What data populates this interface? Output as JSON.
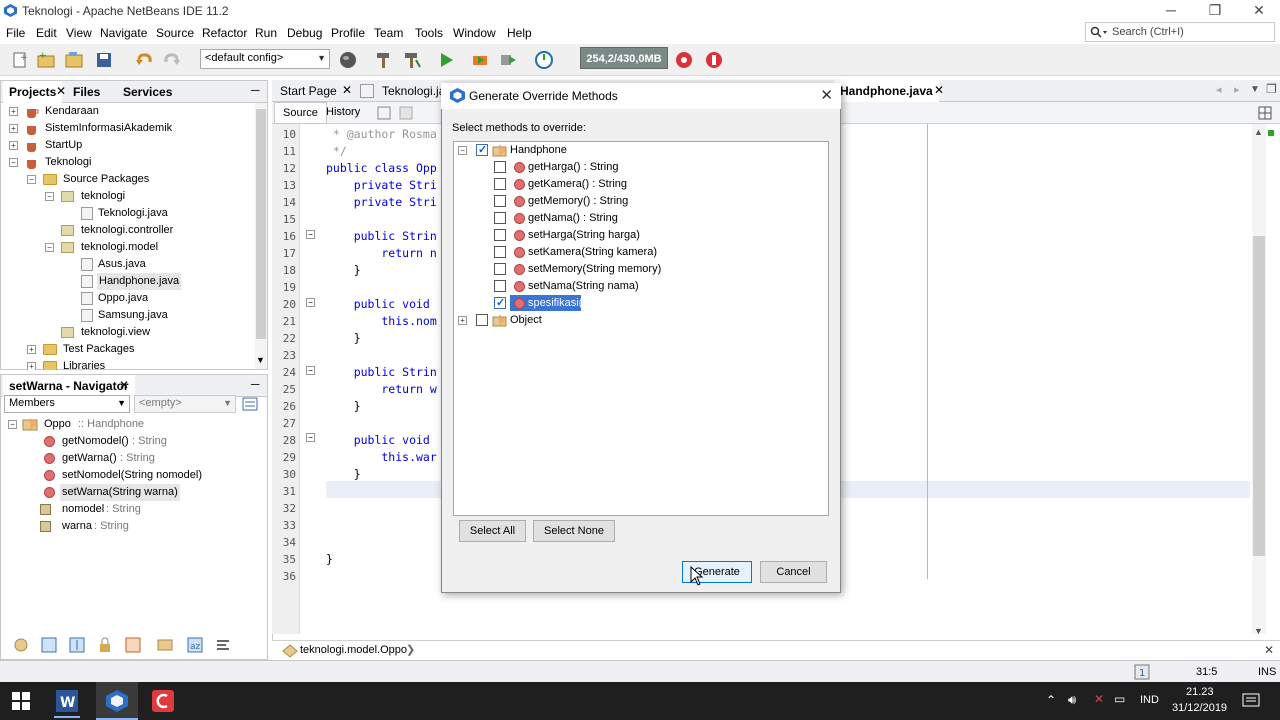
{
  "window": {
    "title": "Teknologi - Apache NetBeans IDE 11.2",
    "minimize": "─",
    "maximize": "❐",
    "close": "✕"
  },
  "menu": [
    "File",
    "Edit",
    "View",
    "Navigate",
    "Source",
    "Refactor",
    "Run",
    "Debug",
    "Profile",
    "Team",
    "Tools",
    "Window",
    "Help"
  ],
  "search": {
    "placeholder": "Search (Ctrl+I)"
  },
  "toolbar": {
    "config": "<default config>",
    "memory": "254,2/430,0MB"
  },
  "projects_panel": {
    "tabs": [
      "Projects",
      "Files",
      "Services"
    ],
    "tree": [
      {
        "label": "Kendaraan"
      },
      {
        "label": "SistemInformasiAkademik"
      },
      {
        "label": "StartUp"
      },
      {
        "label": "Teknologi"
      },
      {
        "label": "Source Packages"
      },
      {
        "label": "teknologi"
      },
      {
        "label": "Teknologi.java"
      },
      {
        "label": "teknologi.controller"
      },
      {
        "label": "teknologi.model"
      },
      {
        "label": "Asus.java"
      },
      {
        "label": "Handphone.java"
      },
      {
        "label": "Oppo.java"
      },
      {
        "label": "Samsung.java"
      },
      {
        "label": "teknologi.view"
      },
      {
        "label": "Test Packages"
      },
      {
        "label": "Libraries"
      }
    ]
  },
  "navigator": {
    "title": "setWarna - Navigator",
    "members_select": "Members",
    "filter": "<empty>",
    "root": "Oppo",
    "root_suffix": ":: Handphone",
    "items": [
      {
        "name": "getNomodel()",
        "type": ": String"
      },
      {
        "name": "getWarna()",
        "type": ": String"
      },
      {
        "name": "setNomodel(String nomodel)",
        "type": ""
      },
      {
        "name": "setWarna(String warna)",
        "type": ""
      },
      {
        "name": "nomodel",
        "type": ": String"
      },
      {
        "name": "warna",
        "type": ": String"
      }
    ]
  },
  "editor": {
    "tabs": [
      "Start Page",
      "Teknologi.java",
      "Handphone.java"
    ],
    "source_tab": "Source",
    "history_tab": "History",
    "breadcrumb": "teknologi.model.Oppo",
    "line_numbers": [
      "10",
      "11",
      "12",
      "13",
      "14",
      "15",
      "16",
      "17",
      "18",
      "19",
      "20",
      "21",
      "22",
      "23",
      "24",
      "25",
      "26",
      "27",
      "28",
      "29",
      "30",
      "31",
      "32",
      "33",
      "34",
      "35",
      "36"
    ],
    "lines": [
      {
        "n": "10",
        "text": " * @author Rosma"
      },
      {
        "n": "11",
        "text": " */"
      },
      {
        "n": "12",
        "text": "public class Opp"
      },
      {
        "n": "13",
        "text": "    private Stri"
      },
      {
        "n": "14",
        "text": "    private Stri"
      },
      {
        "n": "15",
        "text": ""
      },
      {
        "n": "16",
        "text": "    public Strin"
      },
      {
        "n": "17",
        "text": "        return n"
      },
      {
        "n": "18",
        "text": "    }"
      },
      {
        "n": "19",
        "text": ""
      },
      {
        "n": "20",
        "text": "    public void"
      },
      {
        "n": "21",
        "text": "        this.nom"
      },
      {
        "n": "22",
        "text": "    }"
      },
      {
        "n": "23",
        "text": ""
      },
      {
        "n": "24",
        "text": "    public Strin"
      },
      {
        "n": "25",
        "text": "        return w"
      },
      {
        "n": "26",
        "text": "    }"
      },
      {
        "n": "27",
        "text": ""
      },
      {
        "n": "28",
        "text": "    public void"
      },
      {
        "n": "29",
        "text": "        this.war"
      },
      {
        "n": "30",
        "text": "    }"
      },
      {
        "n": "31",
        "text": ""
      },
      {
        "n": "32",
        "text": ""
      },
      {
        "n": "33",
        "text": ""
      },
      {
        "n": "34",
        "text": ""
      },
      {
        "n": "35",
        "text": "}"
      },
      {
        "n": "36",
        "text": ""
      }
    ]
  },
  "dialog": {
    "title": "Generate Override Methods",
    "close": "✕",
    "select_label": "Select methods to override:",
    "root": "Handphone",
    "methods": [
      {
        "label": "getHarga() : String",
        "checked": false
      },
      {
        "label": "getKamera() : String",
        "checked": false
      },
      {
        "label": "getMemory() : String",
        "checked": false
      },
      {
        "label": "getNama() : String",
        "checked": false
      },
      {
        "label": "setHarga(String harga)",
        "checked": false
      },
      {
        "label": "setKamera(String kamera)",
        "checked": false
      },
      {
        "label": "setMemory(String memory)",
        "checked": false
      },
      {
        "label": "setNama(String nama)",
        "checked": false
      },
      {
        "label": "spesifikasi()",
        "checked": true
      }
    ],
    "object_node": "Object",
    "select_all": "Select All",
    "select_none": "Select None",
    "generate": "Generate",
    "cancel": "Cancel"
  },
  "statusbar": {
    "position": "31:5",
    "mode": "INS"
  },
  "taskbar": {
    "lang": "IND",
    "time": "21.23",
    "date": "31/12/2019"
  }
}
